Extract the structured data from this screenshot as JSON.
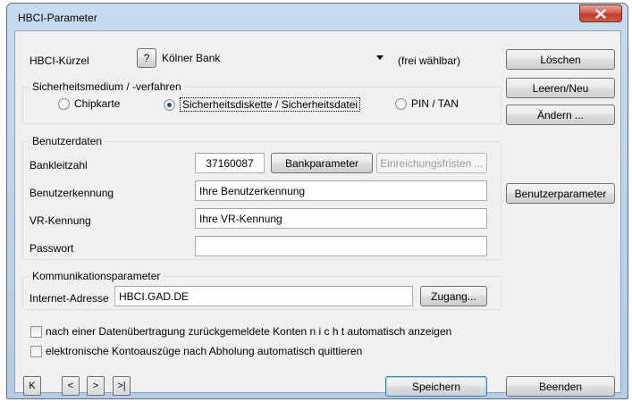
{
  "window": {
    "title": "HBCI-Parameter"
  },
  "kuerzel": {
    "label": "HBCI-Kürzel",
    "help_label": "?",
    "value": "Kölner Bank",
    "hint": "(frei wählbar)"
  },
  "security": {
    "title": "Sicherheitsmedium / -verfahren",
    "options": [
      {
        "label": "Chipkarte",
        "checked": false
      },
      {
        "label": "Sicherheitsdiskette / Sicherheitsdatei",
        "checked": true
      },
      {
        "label": "PIN / TAN",
        "checked": false
      }
    ]
  },
  "userdata": {
    "title": "Benutzerdaten",
    "blz_label": "Bankleitzahl",
    "blz_value": "37160087",
    "bankparameter_label": "Bankparameter",
    "einreichungsfristen_label": "Einreichungsfristen ...",
    "benutzerkennung_label": "Benutzerkennung",
    "benutzerkennung_value": "Ihre Benutzerkennung",
    "vr_label": "VR-Kennung",
    "vr_value": "Ihre VR-Kennung",
    "passwort_label": "Passwort",
    "passwort_value": ""
  },
  "communication": {
    "title": "Kommunikationsparameter",
    "address_label": "Internet-Adresse",
    "address_value": "HBCI.GAD.DE",
    "zugang_label": "Zugang..."
  },
  "options": {
    "check1": "nach einer Datenübertragung zurückgemeldete Konten  n i c h t  automatisch anzeigen",
    "check2": "elektronische Kontoauszüge nach Abholung automatisch quittieren"
  },
  "side_buttons": {
    "loeschen": "Löschen",
    "leeren": "Leeren/Neu",
    "aendern": "Ändern ...",
    "benutzerparameter": "Benutzerparameter"
  },
  "nav": {
    "first": "K",
    "prev": "<",
    "next": ">",
    "last": ">|"
  },
  "footer": {
    "save": "Speichern",
    "quit": "Beenden"
  }
}
